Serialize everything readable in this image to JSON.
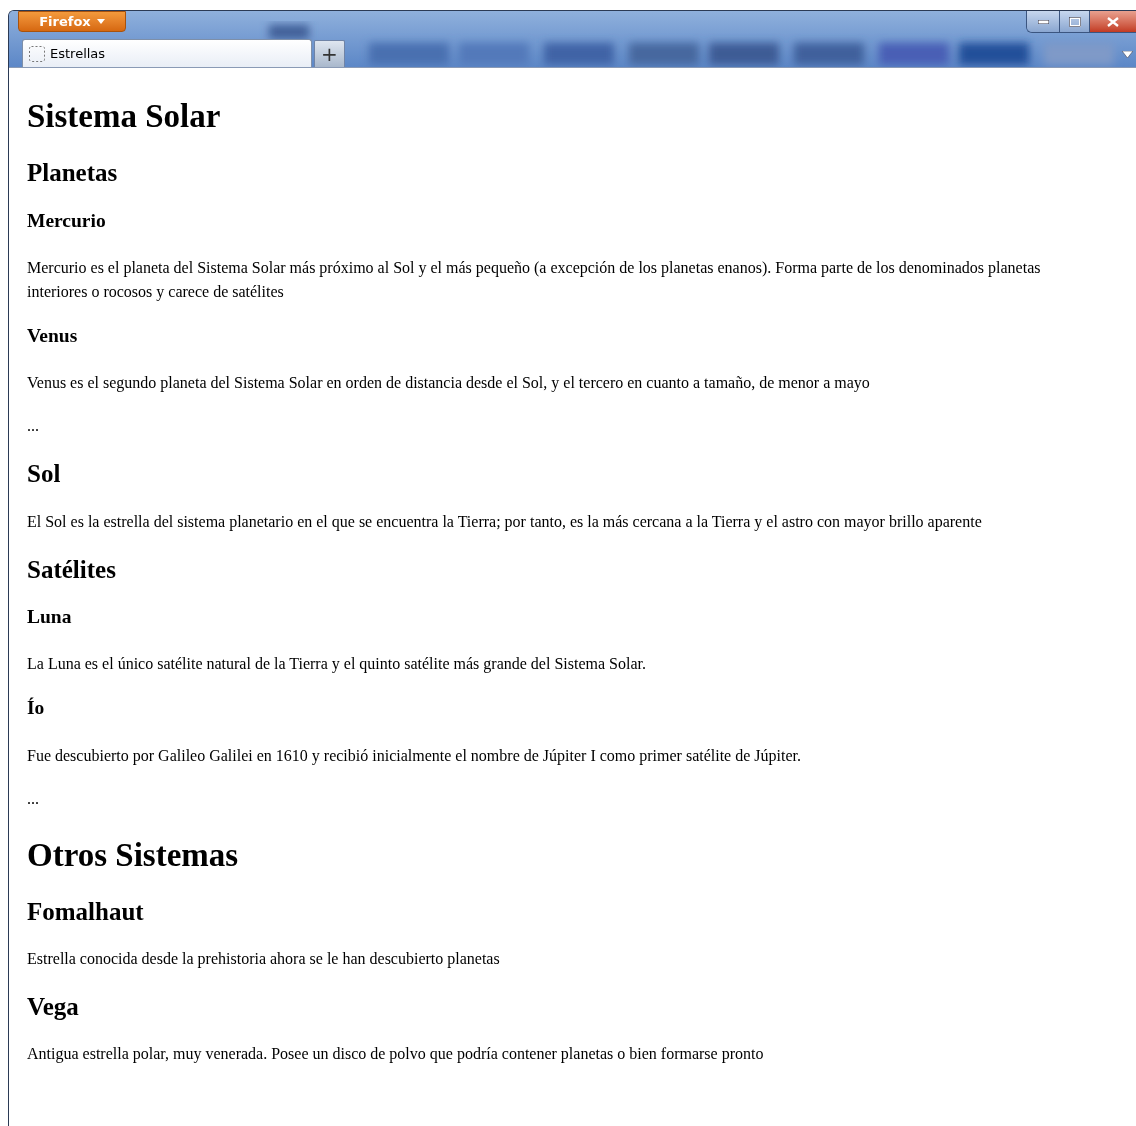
{
  "window": {
    "app_button": "Firefox"
  },
  "tabs": [
    {
      "title": "Estrellas",
      "selected": true
    }
  ],
  "new_tab": "+",
  "content": [
    {
      "kind": "h1",
      "text": "Sistema Solar"
    },
    {
      "kind": "h2",
      "text": "Planetas"
    },
    {
      "kind": "h3",
      "text": "Mercurio"
    },
    {
      "kind": "p",
      "text": "Mercurio es el planeta del Sistema Solar más próximo al Sol y el más pequeño (a excepción de los planetas enanos). Forma parte de los denominados planetas interiores o rocosos y carece de satélites"
    },
    {
      "kind": "h3",
      "text": "Venus"
    },
    {
      "kind": "p",
      "text": "Venus es el segundo planeta del Sistema Solar en orden de distancia desde el Sol, y el tercero en cuanto a tamaño, de menor a mayo"
    },
    {
      "kind": "p",
      "text": "..."
    },
    {
      "kind": "h2",
      "text": "Sol"
    },
    {
      "kind": "p",
      "text": "El Sol es la estrella del sistema planetario en el que se encuentra la Tierra; por tanto, es la más cercana a la Tierra y el astro con mayor brillo aparente"
    },
    {
      "kind": "h2",
      "text": "Satélites"
    },
    {
      "kind": "h3",
      "text": "Luna"
    },
    {
      "kind": "p",
      "text": "La Luna es el único satélite natural de la Tierra y el quinto satélite más grande del Sistema Solar."
    },
    {
      "kind": "h3",
      "text": "Ío"
    },
    {
      "kind": "p",
      "text": "Fue descubierto por Galileo Galilei en 1610 y recibió inicialmente el nombre de Júpiter I como primer satélite de Júpiter."
    },
    {
      "kind": "p",
      "text": "..."
    },
    {
      "kind": "h1",
      "text": "Otros Sistemas"
    },
    {
      "kind": "h2",
      "text": "Fomalhaut"
    },
    {
      "kind": "p",
      "text": "Estrella conocida desde la prehistoria ahora se le han descubierto planetas"
    },
    {
      "kind": "h2",
      "text": "Vega"
    },
    {
      "kind": "p",
      "text": "Antigua estrella polar, muy venerada. Posee un disco de polvo que podría contener planetas o bien formarse pronto"
    }
  ]
}
